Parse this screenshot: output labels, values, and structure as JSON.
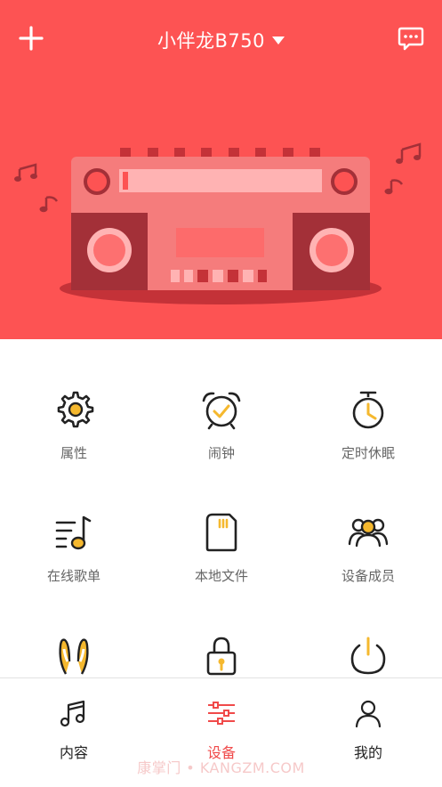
{
  "header": {
    "title": "小伴龙B750",
    "add_icon": "plus-icon",
    "dropdown_icon": "caret-down-icon",
    "message_icon": "chat-bubble-icon",
    "background_color": "#fd5353"
  },
  "features": [
    {
      "label": "属性",
      "icon": "gear-icon"
    },
    {
      "label": "闹钟",
      "icon": "alarm-clock-icon"
    },
    {
      "label": "定时休眠",
      "icon": "timer-icon"
    },
    {
      "label": "在线歌单",
      "icon": "playlist-icon"
    },
    {
      "label": "本地文件",
      "icon": "sd-card-icon"
    },
    {
      "label": "设备成员",
      "icon": "members-icon"
    },
    {
      "label": "",
      "icon": "bunny-ears-icon"
    },
    {
      "label": "",
      "icon": "lock-icon"
    },
    {
      "label": "",
      "icon": "power-icon"
    }
  ],
  "tabs": [
    {
      "label": "内容",
      "icon": "music-note-icon",
      "active": false
    },
    {
      "label": "设备",
      "icon": "sliders-icon",
      "active": true
    },
    {
      "label": "我的",
      "icon": "person-icon",
      "active": false
    }
  ],
  "watermark": "康掌门 • KANGZM.COM",
  "colors": {
    "accent": "#fd5353",
    "icon_yellow": "#f5b82e",
    "active_tab": "#f04a4a"
  }
}
